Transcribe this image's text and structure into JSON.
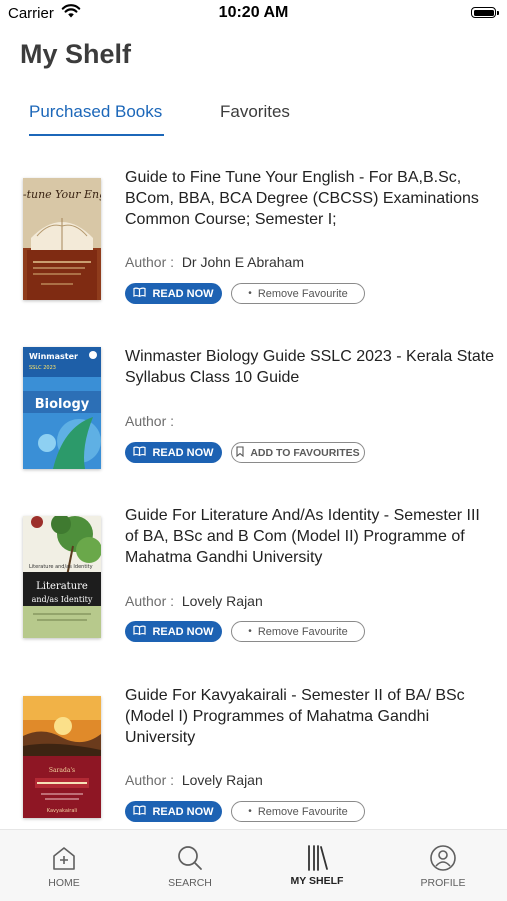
{
  "status_bar": {
    "carrier": "Carrier",
    "time": "10:20 AM"
  },
  "page_title": "My Shelf",
  "tabs": [
    {
      "label": "Purchased Books",
      "active": true
    },
    {
      "label": "Favorites",
      "active": false
    }
  ],
  "author_label": "Author :",
  "read_now_label": "READ NOW",
  "books": [
    {
      "title": "Guide to Fine Tune Your English - For  BA,B.Sc, BCom, BBA, BCA Degree (CBCSS) Examinations Common Course; Semester I;",
      "author": "Dr John E Abraham",
      "favourite_label": "Remove Favourite",
      "is_favourite": true,
      "cover_text": "Fine-tune Your English"
    },
    {
      "title": "Winmaster Biology Guide SSLC 2023 - Kerala State Syllabus Class 10 Guide",
      "author": "",
      "favourite_label": "ADD TO FAVOURITES",
      "is_favourite": false,
      "cover_text": "Biology"
    },
    {
      "title": "Guide For Literature And/As Identity - Semester III of BA, BSc and B Com (Model II) Programme of Mahatma Gandhi University",
      "author": "Lovely Rajan",
      "favourite_label": "Remove Favourite",
      "is_favourite": true,
      "cover_text": "Literature and/as Identity"
    },
    {
      "title": "Guide For Kavyakairali -  Semester II of BA/ BSc (Model I) Programmes of Mahatma Gandhi University",
      "author": "Lovely Rajan",
      "favourite_label": "Remove Favourite",
      "is_favourite": true,
      "cover_text": "Kavyakairali"
    }
  ],
  "bottom_nav": [
    {
      "label": "HOME",
      "icon": "home-icon",
      "active": false
    },
    {
      "label": "SEARCH",
      "icon": "search-icon",
      "active": false
    },
    {
      "label": "MY SHELF",
      "icon": "shelf-icon",
      "active": true
    },
    {
      "label": "PROFILE",
      "icon": "profile-icon",
      "active": false
    }
  ],
  "colors": {
    "accent": "#1c67b9",
    "read_button": "#1d62b3"
  }
}
